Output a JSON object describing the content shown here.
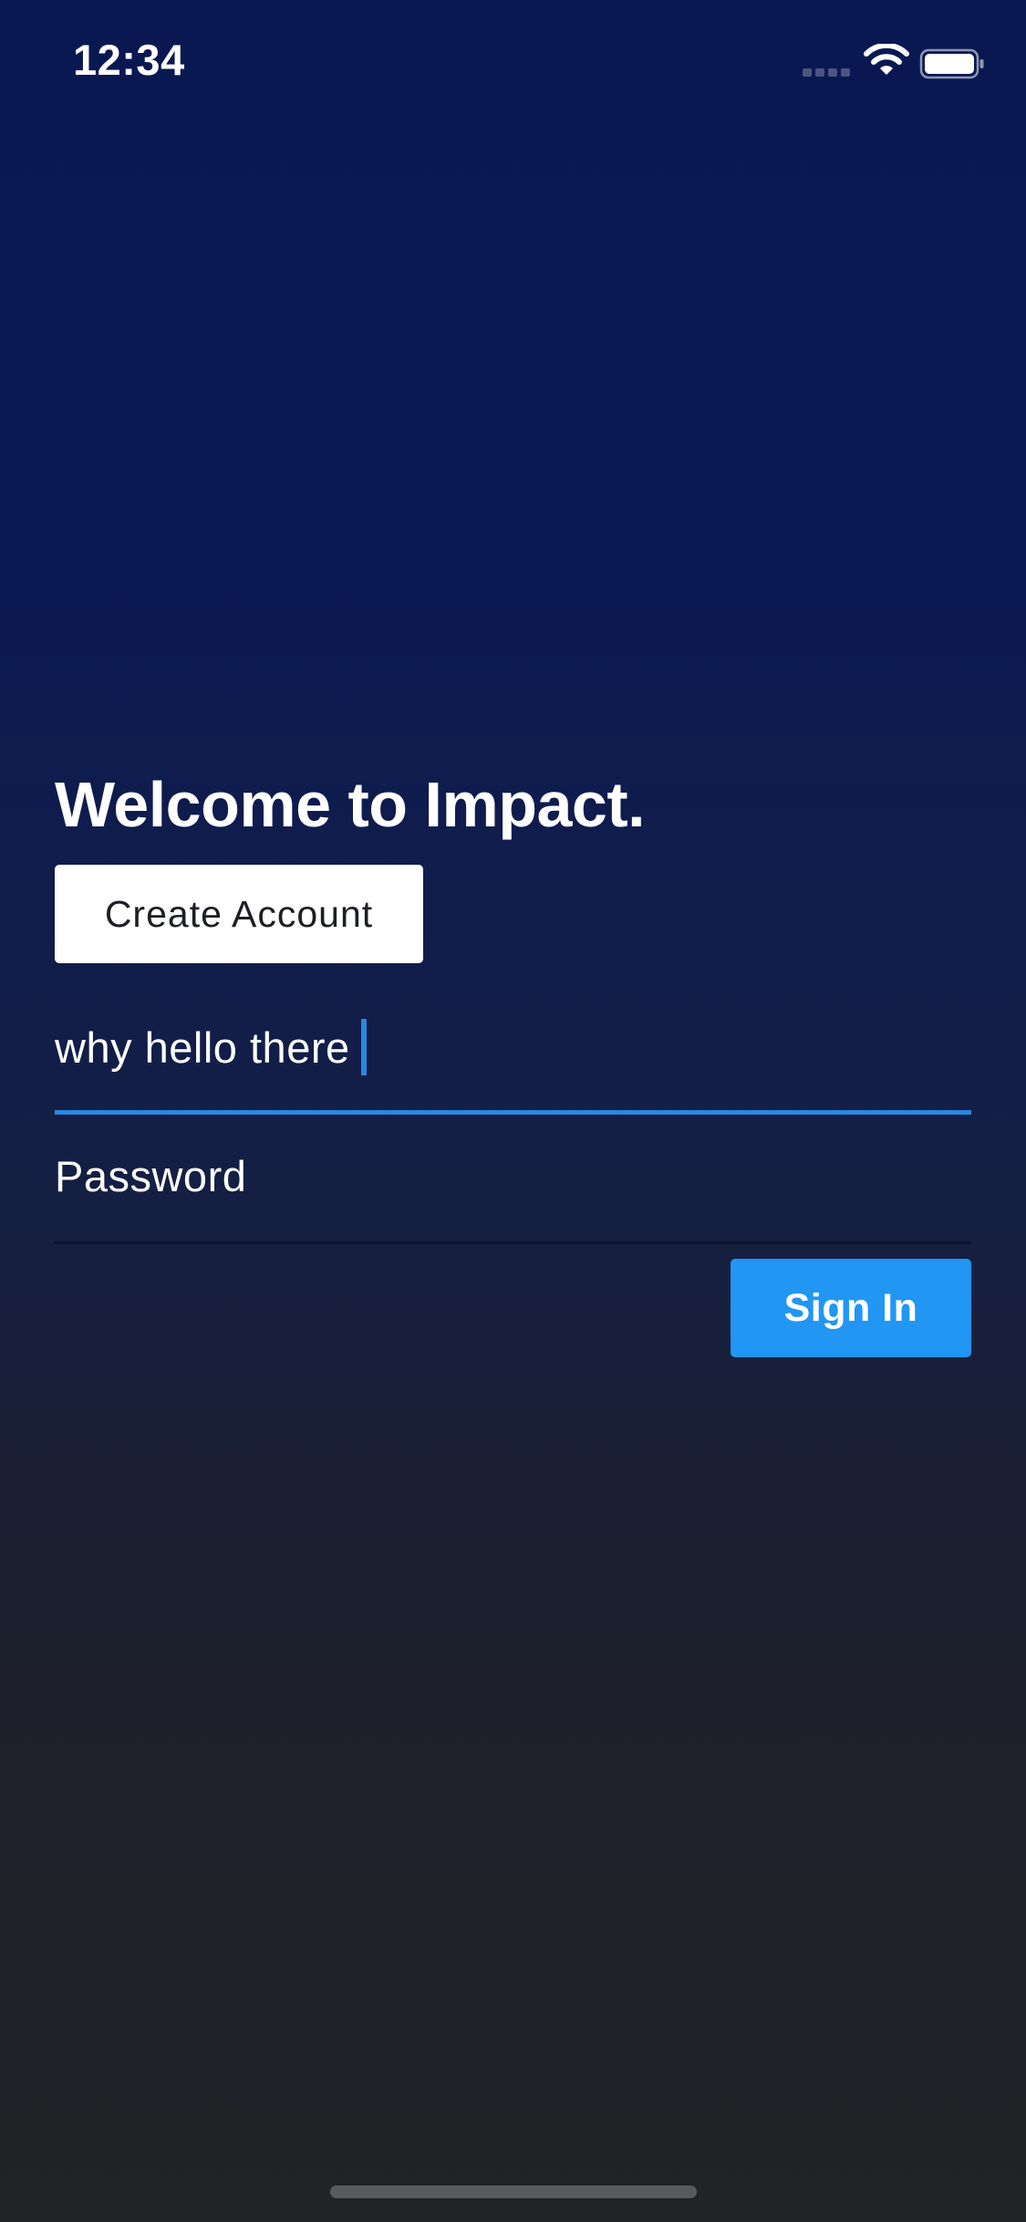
{
  "status_bar": {
    "time": "12:34",
    "icons": [
      "signal-icon",
      "wifi-icon",
      "battery-icon"
    ]
  },
  "welcome": {
    "title": "Welcome to Impact."
  },
  "buttons": {
    "create_account_label": "Create Account",
    "sign_in_label": "Sign In"
  },
  "form": {
    "username_value": "why hello there",
    "password_placeholder": "Password"
  },
  "colors": {
    "background_top": "#0a1852",
    "background_bottom": "#222325",
    "accent": "#2196f3",
    "focus_underline": "#2b86e0",
    "create_account_bg": "#ffffff"
  }
}
